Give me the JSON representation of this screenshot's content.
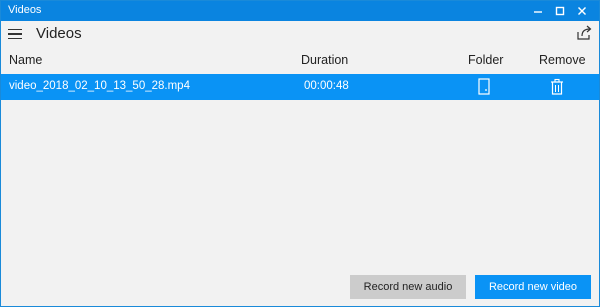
{
  "window": {
    "title": "Videos",
    "accent": "#0a84e0"
  },
  "appbar": {
    "title": "Videos"
  },
  "table": {
    "columns": {
      "name": "Name",
      "duration": "Duration",
      "folder": "Folder",
      "remove": "Remove"
    },
    "rows": [
      {
        "name": "video_2018_02_10_13_50_28.mp4",
        "duration": "00:00:48"
      }
    ],
    "selected_color": "#0a93f5"
  },
  "buttons": {
    "record_audio": "Record new audio",
    "record_video": "Record new video"
  },
  "icons": {
    "minimize": "minimize-icon",
    "maximize": "maximize-icon",
    "close": "close-icon",
    "menu": "hamburger-icon",
    "share": "share-icon",
    "folder": "folder-icon",
    "remove": "trash-icon"
  }
}
